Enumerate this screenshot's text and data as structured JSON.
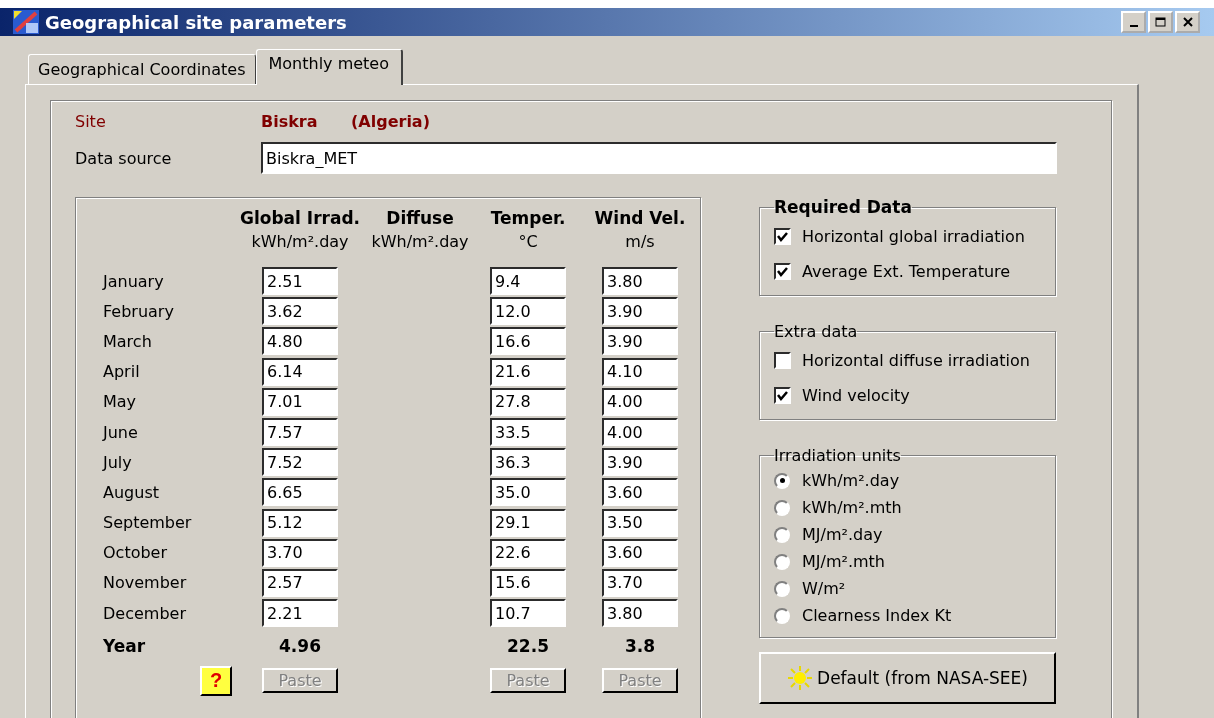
{
  "window": {
    "title": "Geographical site parameters"
  },
  "tabs": [
    {
      "label": "Geographical Coordinates",
      "selected": false
    },
    {
      "label": "Monthly meteo",
      "selected": true
    }
  ],
  "site": {
    "label": "Site",
    "name": "Biskra",
    "country": "(Algeria)"
  },
  "data_source": {
    "label": "Data source",
    "value": "Biskra_MET"
  },
  "table": {
    "months": [
      "January",
      "February",
      "March",
      "April",
      "May",
      "June",
      "July",
      "August",
      "September",
      "October",
      "November",
      "December"
    ],
    "year_label": "Year",
    "columns": [
      {
        "title": "Global Irrad.",
        "unit": "kWh/m².day",
        "values": [
          "2.51",
          "3.62",
          "4.80",
          "6.14",
          "7.01",
          "7.57",
          "7.52",
          "6.65",
          "5.12",
          "3.70",
          "2.57",
          "2.21"
        ],
        "year": "4.96",
        "paste_button": {
          "label": "Paste",
          "disabled": true
        }
      },
      {
        "title": "Diffuse",
        "unit": "kWh/m².day"
      },
      {
        "title": "Temper.",
        "unit": "°C",
        "values": [
          "9.4",
          "12.0",
          "16.6",
          "21.6",
          "27.8",
          "33.5",
          "36.3",
          "35.0",
          "29.1",
          "22.6",
          "15.6",
          "10.7"
        ],
        "year": "22.5",
        "paste_button": {
          "label": "Paste",
          "disabled": true
        }
      },
      {
        "title": "Wind Vel.",
        "unit": "m/s",
        "values": [
          "3.80",
          "3.90",
          "3.90",
          "4.10",
          "4.00",
          "4.00",
          "3.90",
          "3.60",
          "3.50",
          "3.60",
          "3.70",
          "3.80"
        ],
        "year": "3.8",
        "paste_button": {
          "label": "Paste",
          "disabled": true
        }
      }
    ]
  },
  "help_button": {
    "glyph": "?"
  },
  "required_data": {
    "title": "Required Data",
    "items": [
      {
        "label": "Horizontal global irradiation",
        "checked": true
      },
      {
        "label": "Average Ext. Temperature",
        "checked": true
      }
    ]
  },
  "extra_data": {
    "title": "Extra data",
    "items": [
      {
        "label": "Horizontal diffuse irradiation",
        "checked": false
      },
      {
        "label": "Wind velocity",
        "checked": true
      }
    ]
  },
  "irradiation_units": {
    "title": "Irradiation units",
    "options": [
      {
        "label": "kWh/m².day",
        "selected": true
      },
      {
        "label": "kWh/m².mth",
        "selected": false
      },
      {
        "label": "MJ/m².day",
        "selected": false
      },
      {
        "label": "MJ/m².mth",
        "selected": false
      },
      {
        "label": "W/m²",
        "selected": false
      },
      {
        "label": "Clearness Index Kt",
        "selected": false
      }
    ]
  },
  "default_button": {
    "label": "Default (from NASA-SEE)"
  }
}
